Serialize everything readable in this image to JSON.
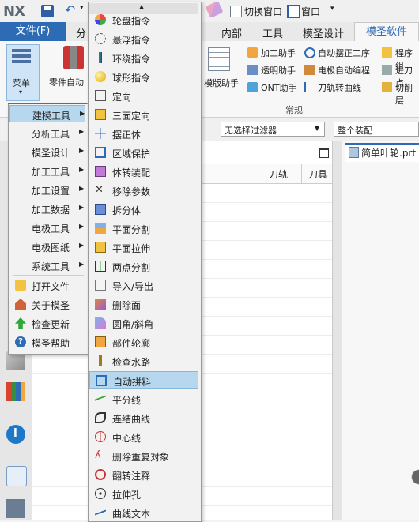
{
  "app": {
    "logo": "NX",
    "switch_window": "切换窗口",
    "window_menu": "窗口"
  },
  "tabs": {
    "file": "文件(F)",
    "partial": "分",
    "inner": "内部",
    "tool": "工具",
    "mold_design": "模圣设计",
    "mold_software": "模圣软件"
  },
  "ribbon": {
    "menu_label": "菜单",
    "part_label": "零件自动",
    "template_label": "模版助手",
    "buttons": [
      {
        "label": "加工助手"
      },
      {
        "label": "自动摆正工序"
      },
      {
        "label": "程序组"
      },
      {
        "label": "透明助手"
      },
      {
        "label": "电极自动编程"
      },
      {
        "label": "进刀点"
      },
      {
        "label": "ONT助手"
      },
      {
        "label": "刀轨转曲线"
      },
      {
        "label": "切削层"
      }
    ],
    "group_label": "常规"
  },
  "filter": {
    "selection_filter": "无选择过滤器",
    "assembly": "整个装配"
  },
  "navigator": {
    "col_tool_path": "刀轨",
    "col_tool": "刀具"
  },
  "view": {
    "tab_label": "简单叶轮.prt"
  },
  "main_menu": {
    "items": [
      {
        "label": "建模工具",
        "has_submenu": true
      },
      {
        "label": "分析工具",
        "has_submenu": true
      },
      {
        "label": "模圣设计",
        "has_submenu": true
      },
      {
        "label": "加工工具",
        "has_submenu": true
      },
      {
        "label": "加工设置",
        "has_submenu": true
      },
      {
        "label": "加工数据",
        "has_submenu": true
      },
      {
        "label": "电极工具",
        "has_submenu": true
      },
      {
        "label": "电极图纸",
        "has_submenu": true
      },
      {
        "label": "系统工具",
        "has_submenu": true
      },
      {
        "label": "打开文件",
        "has_submenu": false
      },
      {
        "label": "关于模圣",
        "has_submenu": false
      },
      {
        "label": "检查更新",
        "has_submenu": false
      },
      {
        "label": "模圣帮助",
        "has_submenu": false
      }
    ],
    "highlighted": "建模工具"
  },
  "sub_menu": {
    "items": [
      {
        "label": "轮盘指令",
        "icon": "wheel-icon"
      },
      {
        "label": "悬浮指令",
        "icon": "float-icon"
      },
      {
        "label": "环绕指令",
        "icon": "orbit-icon"
      },
      {
        "label": "球形指令",
        "icon": "sphere-icon"
      },
      {
        "label": "定向",
        "icon": "orient-icon"
      },
      {
        "label": "三面定向",
        "icon": "three-face-icon"
      },
      {
        "label": "摆正体",
        "icon": "align-body-icon"
      },
      {
        "label": "区域保护",
        "icon": "region-protect-icon"
      },
      {
        "label": "体转装配",
        "icon": "body-assembly-icon"
      },
      {
        "label": "移除参数",
        "icon": "remove-param-icon"
      },
      {
        "label": "拆分体",
        "icon": "split-body-icon"
      },
      {
        "label": "平面分割",
        "icon": "plane-split-icon"
      },
      {
        "label": "平面拉伸",
        "icon": "plane-extrude-icon"
      },
      {
        "label": "两点分割",
        "icon": "two-point-split-icon"
      },
      {
        "label": "导入/导出",
        "icon": "import-export-icon"
      },
      {
        "label": "删除面",
        "icon": "delete-face-icon"
      },
      {
        "label": "圆角/斜角",
        "icon": "fillet-icon"
      },
      {
        "label": "部件轮廓",
        "icon": "outline-icon"
      },
      {
        "label": "检查水路",
        "icon": "water-check-icon"
      },
      {
        "label": "自动拼料",
        "icon": "auto-stock-icon"
      },
      {
        "label": "平分线",
        "icon": "bisector-icon"
      },
      {
        "label": "连结曲线",
        "icon": "join-curve-icon"
      },
      {
        "label": "中心线",
        "icon": "centerline-icon"
      },
      {
        "label": "删除重复对象",
        "icon": "dedupe-icon"
      },
      {
        "label": "翻转注释",
        "icon": "flip-note-icon"
      },
      {
        "label": "拉伸孔",
        "icon": "extrude-hole-icon"
      },
      {
        "label": "曲线文本",
        "icon": "curve-text-icon"
      }
    ],
    "highlighted": "自动拼料"
  },
  "colors": {
    "accent": "#2d6bb5",
    "highlight": "#b7d7ee"
  }
}
